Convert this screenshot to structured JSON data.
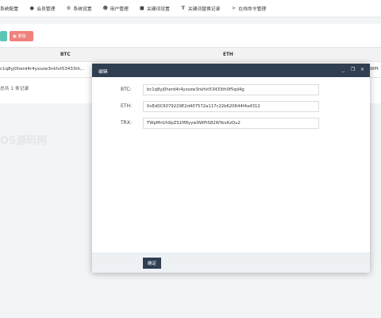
{
  "nav": {
    "items": [
      {
        "label": "系统配置",
        "icon": ""
      },
      {
        "label": "会员管理",
        "icon": "user-icon"
      },
      {
        "label": "系统设置",
        "icon": "gear-icon"
      },
      {
        "label": "用户管理",
        "icon": "person-icon"
      },
      {
        "label": "关键词设置",
        "icon": "document-icon"
      },
      {
        "label": "关键词替换记录",
        "icon": "text-icon"
      },
      {
        "label": "在线命令管理",
        "icon": "terminal-icon"
      }
    ]
  },
  "toolbar": {
    "delete_label": "删除"
  },
  "table": {
    "headers": [
      "BTC",
      "ETH"
    ],
    "rows": [
      {
        "btc": "c1q8yj0herd4r4yxszw3nkfvt53433th...",
        "eth": "",
        "trx": "WPt"
      }
    ],
    "footer": "总共 1 条记录"
  },
  "watermark": "OS源码网",
  "dialog": {
    "title": "编辑",
    "controls": {
      "minimize": "_",
      "maximize": "❐",
      "close": "×"
    },
    "fields": [
      {
        "label": "BTC:",
        "value": "bc1q8yj0herd4r4yxszw3nkfvt53433th0f5qd4g"
      },
      {
        "label": "ETH:",
        "value": "0xEd0C6079229E2d407572a117c22b620644f4a4312"
      },
      {
        "label": "TRX:",
        "value": "TWpMnUh9pZS1M8yyw9WPtS82WYevKzQu2"
      }
    ],
    "confirm_label": "确定"
  },
  "colors": {
    "dialog_header": "#2f3e51",
    "add_button": "#5cc6b5",
    "delete_button": "#f0807a"
  }
}
